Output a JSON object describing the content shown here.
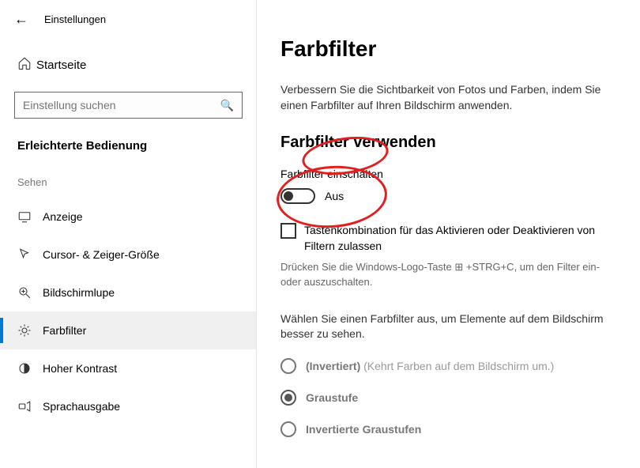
{
  "header": {
    "window_title": "Einstellungen"
  },
  "sidebar": {
    "home_label": "Startseite",
    "search_placeholder": "Einstellung suchen",
    "category_title": "Erleichterte Bedienung",
    "section_heading": "Sehen",
    "items": [
      {
        "label": "Anzeige",
        "icon": "display-icon"
      },
      {
        "label": "Cursor- & Zeiger-Größe",
        "icon": "cursor-icon"
      },
      {
        "label": "Bildschirmlupe",
        "icon": "magnifier-icon"
      },
      {
        "label": "Farbfilter",
        "icon": "color-filter-icon"
      },
      {
        "label": "Hoher Kontrast",
        "icon": "contrast-icon"
      },
      {
        "label": "Sprachausgabe",
        "icon": "narrator-icon"
      }
    ],
    "active_index": 3
  },
  "main": {
    "title": "Farbfilter",
    "intro": "Verbessern Sie die Sichtbarkeit von Fotos und Farben, indem Sie einen Farbfilter auf Ihren Bildschirm anwenden.",
    "section_title": "Farbfilter verwenden",
    "toggle_label": "Farbfilter einschalten",
    "toggle_state": "Aus",
    "checkbox_label": "Tastenkombination für das Aktivieren oder Deaktivieren von Filtern zulassen",
    "hint": "Drücken Sie die Windows-Logo-Taste ⊞ +STRG+C, um den Filter ein- oder auszuschalten.",
    "choose_desc": "Wählen Sie einen Farbfilter aus, um Elemente auf dem Bildschirm besser zu sehen.",
    "options": [
      {
        "label": "(Invertiert)",
        "sub": "(Kehrt Farben auf dem Bildschirm um.)",
        "checked": false
      },
      {
        "label": "Graustufe",
        "sub": "",
        "checked": true
      },
      {
        "label": "Invertierte Graustufen",
        "sub": "",
        "checked": false
      }
    ]
  },
  "colors": {
    "accent": "#0078d4",
    "annotation": "#e02020"
  }
}
